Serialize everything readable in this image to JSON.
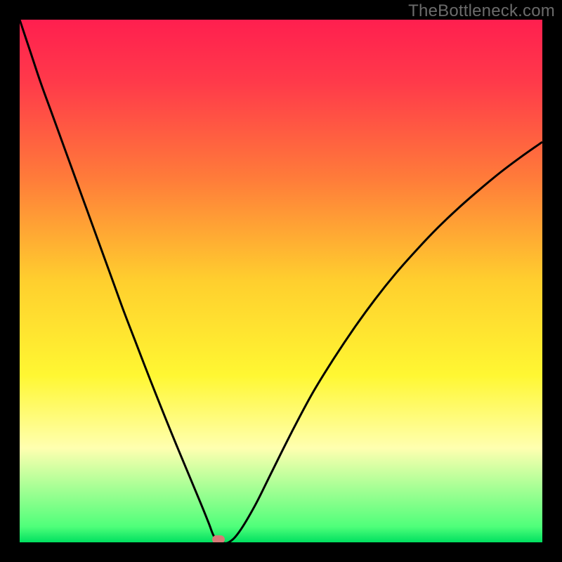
{
  "watermark": "TheBottleneck.com",
  "chart_data": {
    "type": "line",
    "title": "",
    "xlabel": "",
    "ylabel": "",
    "xlim": [
      0,
      100
    ],
    "ylim": [
      0,
      100
    ],
    "gradient_stops": [
      {
        "offset": 0.0,
        "color": "#ff1f4f"
      },
      {
        "offset": 0.12,
        "color": "#ff3a4a"
      },
      {
        "offset": 0.3,
        "color": "#ff7a3a"
      },
      {
        "offset": 0.5,
        "color": "#ffcf2e"
      },
      {
        "offset": 0.68,
        "color": "#fff732"
      },
      {
        "offset": 0.82,
        "color": "#ffffb0"
      },
      {
        "offset": 0.97,
        "color": "#4fff7a"
      },
      {
        "offset": 1.0,
        "color": "#00e060"
      }
    ],
    "series": [
      {
        "name": "bottleneck-curve",
        "x": [
          0.0,
          2,
          4,
          6,
          8,
          10,
          12,
          14,
          16,
          18,
          20,
          22,
          24,
          26,
          28,
          30,
          32,
          33.5,
          35,
          36.2,
          37,
          37.7,
          38.5,
          40,
          42,
          45,
          48,
          52,
          56,
          60,
          64,
          68,
          72,
          76,
          80,
          84,
          88,
          92,
          96,
          100
        ],
        "y": [
          100,
          94,
          88,
          82.5,
          77,
          71.5,
          66,
          60.5,
          55,
          49.5,
          44,
          38.8,
          33.6,
          28.5,
          23.5,
          18.6,
          13.8,
          10.2,
          6.6,
          3.6,
          1.5,
          0.4,
          0.0,
          0.0,
          2.0,
          7.0,
          13.0,
          21.0,
          28.5,
          35.0,
          41.0,
          46.5,
          51.5,
          56.0,
          60.2,
          64.0,
          67.5,
          70.8,
          73.8,
          76.6
        ]
      }
    ],
    "marker": {
      "x": 38.0,
      "y": 0.5,
      "color": "#d77a77"
    }
  }
}
